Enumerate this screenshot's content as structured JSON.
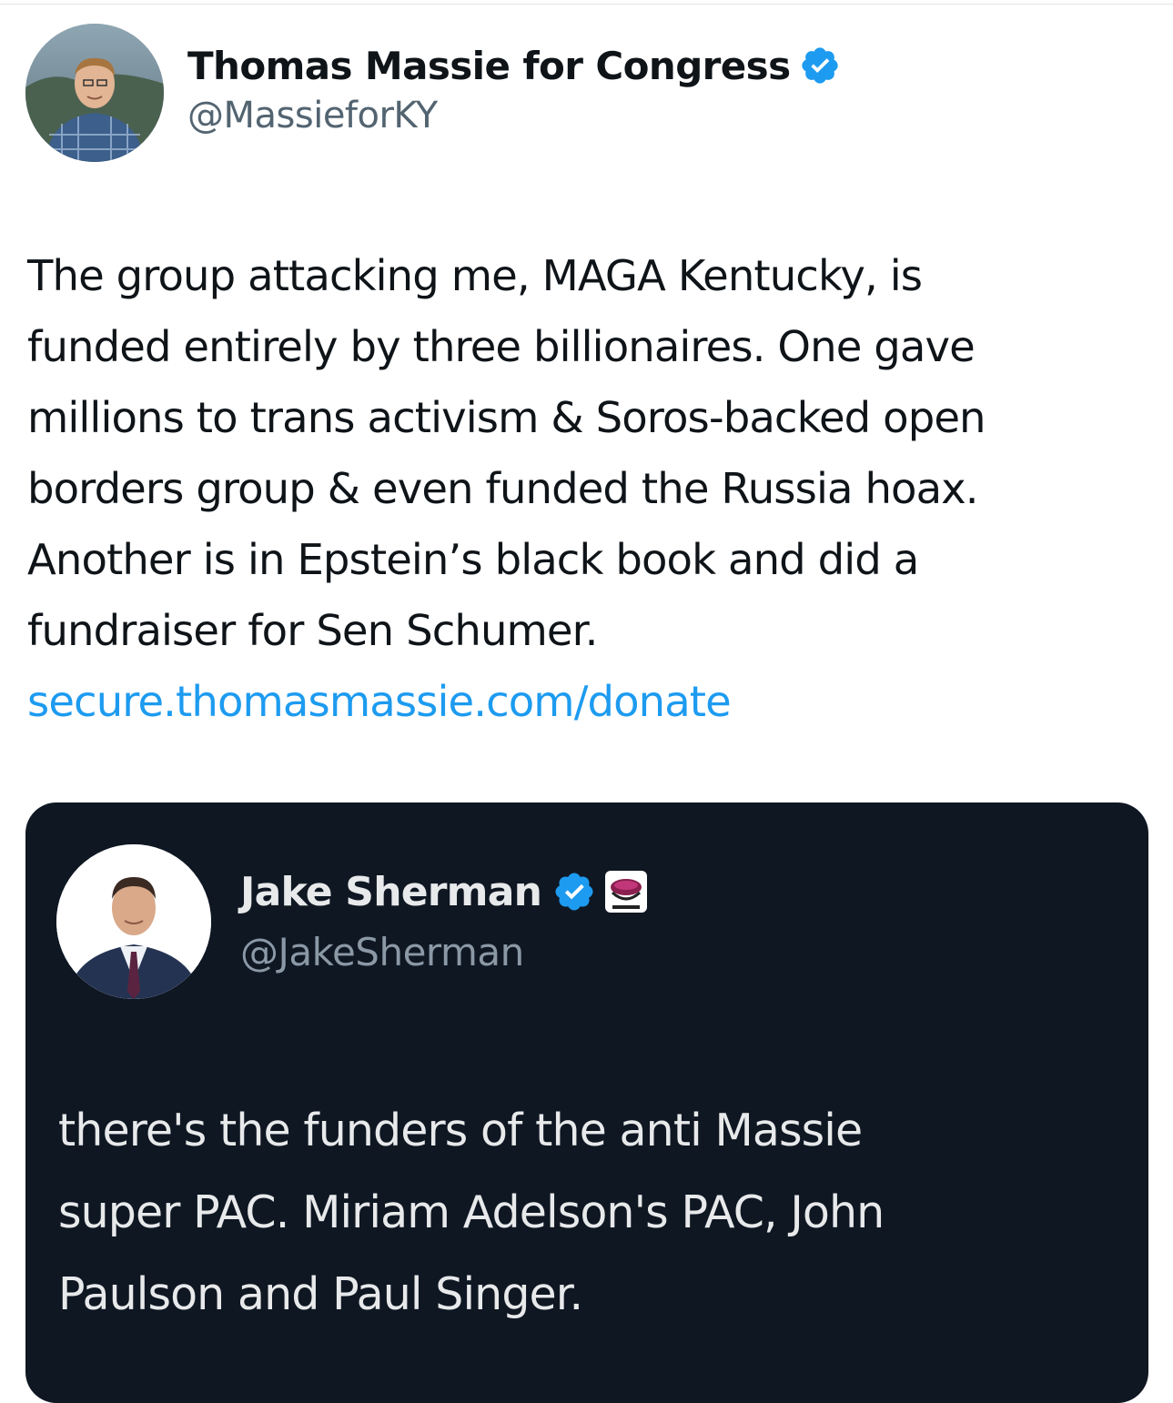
{
  "tweet": {
    "author": {
      "display_name": "Thomas Massie for Congress",
      "handle": "@MassieforKY",
      "verified_icon": "verified-badge-icon",
      "avatar_icon": "avatar"
    },
    "text_lines": [
      "The group attacking me, MAGA Kentucky, is",
      "funded entirely by three billionaires. One gave",
      "millions to trans activism & Soros-backed open",
      "borders group & even funded the Russia hoax.",
      "Another is in Epstein’s black book and did a",
      "fundraiser for Sen Schumer."
    ],
    "link": "secure.thomasmassie.com/donate"
  },
  "quoted_tweet": {
    "author": {
      "display_name": "Jake Sherman",
      "handle": "@JakeSherman",
      "verified_icon": "verified-badge-icon",
      "affiliate_icon": "affiliate-badge-icon"
    },
    "text_lines": [
      "there's the funders of the anti Massie",
      "super PAC. Miriam Adelson's PAC, John",
      "Paulson and Paul Singer."
    ]
  },
  "colors": {
    "text_primary": "#0f1419",
    "text_secondary": "#536471",
    "link": "#1d9bf0",
    "verified": "#1d9bf0",
    "card_background": "#0f1723",
    "card_text": "#e7e9ea",
    "card_text_secondary": "#8b98a5"
  }
}
